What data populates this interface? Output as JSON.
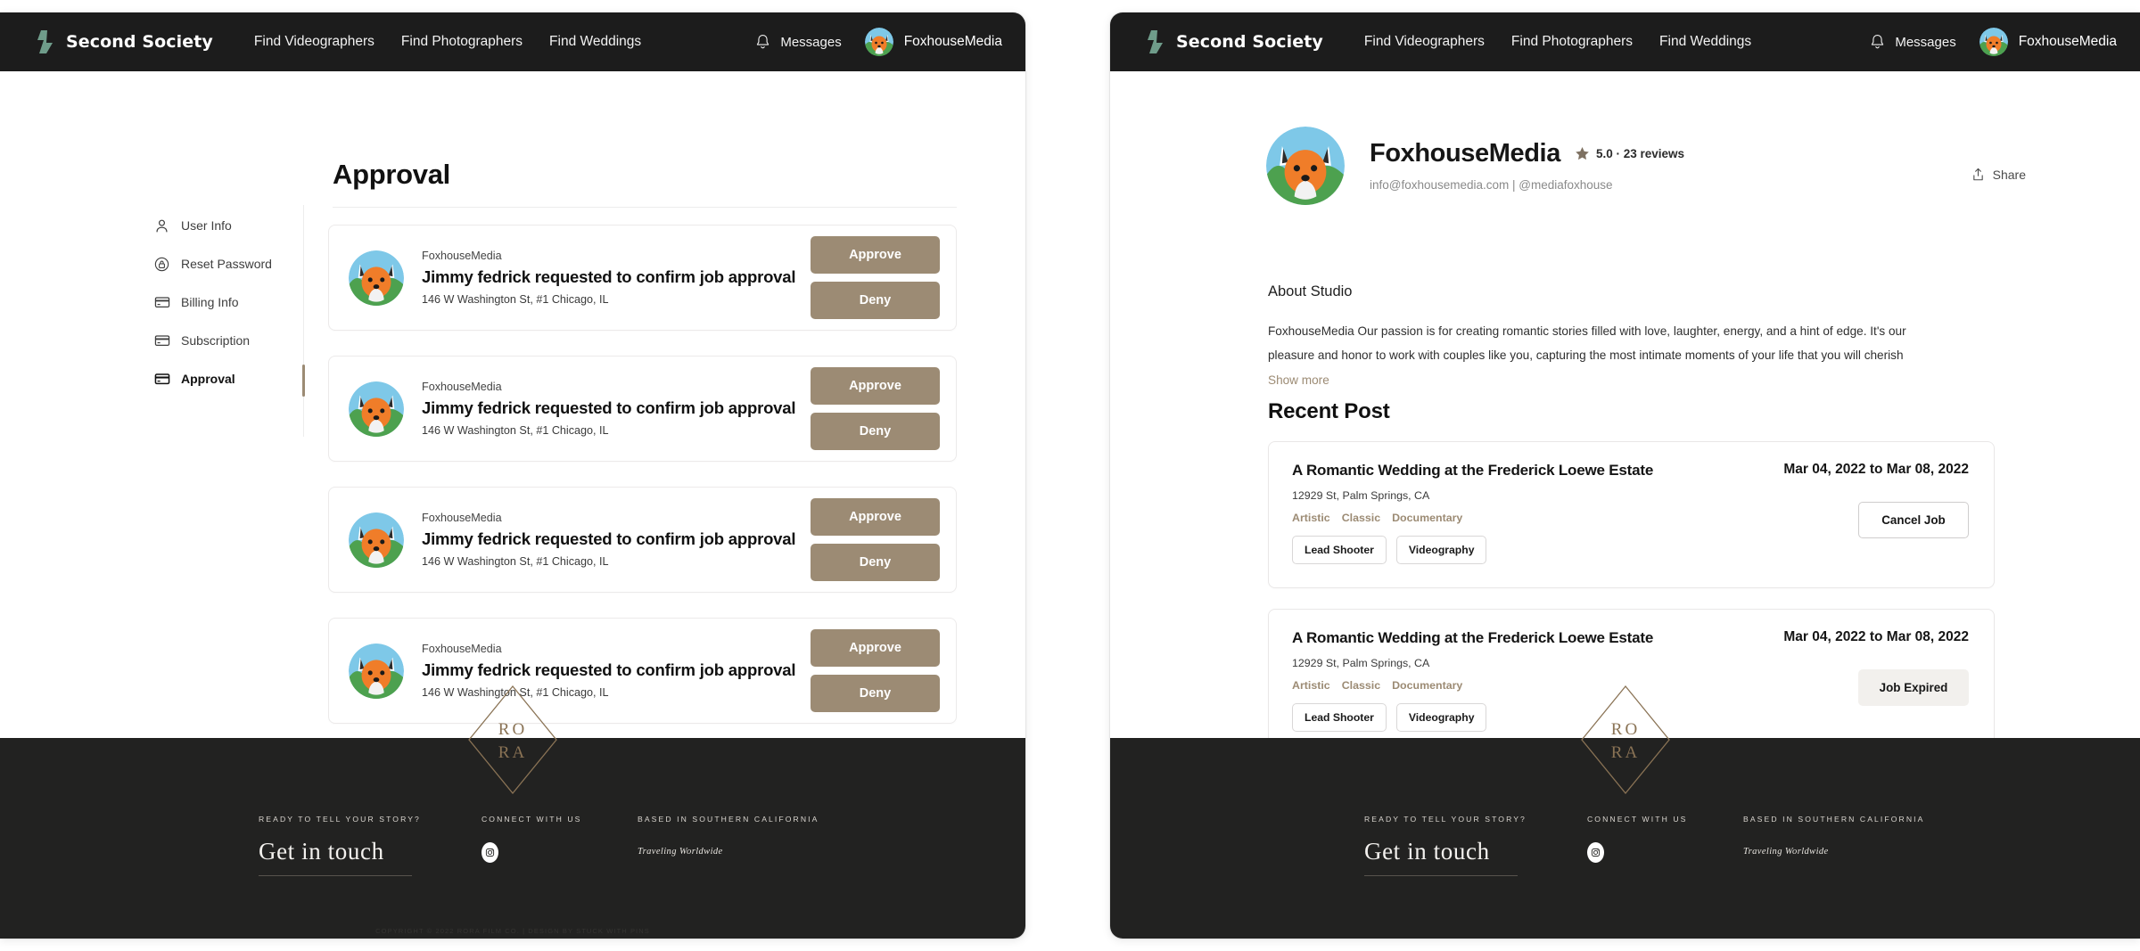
{
  "colors": {
    "topbar_bg": "#1c1c1c",
    "footer_bg": "#222221",
    "accent_tan": "#9c8b74",
    "brand_green": "#6f9c8a",
    "expired_bg": "#f2f0ed"
  },
  "topbar": {
    "brand_name": "Second Society",
    "nav": [
      {
        "label": "Find Videographers"
      },
      {
        "label": "Find Photographers"
      },
      {
        "label": "Find Weddings"
      }
    ],
    "messages_label": "Messages",
    "user_name": "FoxhouseMedia"
  },
  "left_panel": {
    "page_title": "Approval",
    "sidebar": [
      {
        "label": "User Info",
        "icon": "user-icon",
        "active": false
      },
      {
        "label": "Reset Password",
        "icon": "lock-circle-icon",
        "active": false
      },
      {
        "label": "Billing Info",
        "icon": "credit-card-icon",
        "active": false
      },
      {
        "label": "Subscription",
        "icon": "credit-card-icon",
        "active": false
      },
      {
        "label": "Approval",
        "icon": "credit-card-icon",
        "active": true
      }
    ],
    "approve_label": "Approve",
    "deny_label": "Deny",
    "cards": [
      {
        "studio": "FoxhouseMedia",
        "message": "Jimmy fedrick requested to confirm job approval",
        "address": "146 W Washington St, #1 Chicago, IL"
      },
      {
        "studio": "FoxhouseMedia",
        "message": "Jimmy fedrick requested to confirm job approval",
        "address": "146 W Washington St, #1 Chicago, IL"
      },
      {
        "studio": "FoxhouseMedia",
        "message": "Jimmy fedrick requested to confirm job approval",
        "address": "146 W Washington St, #1 Chicago, IL"
      },
      {
        "studio": "FoxhouseMedia",
        "message": "Jimmy fedrick requested to confirm job approval",
        "address": "146 W Washington St, #1 Chicago, IL"
      }
    ]
  },
  "right_panel": {
    "profile": {
      "name": "FoxhouseMedia",
      "rating": "5.0 · 23 reviews",
      "contact": "info@foxhousemedia.com | @mediafoxhouse",
      "share_label": "Share"
    },
    "about": {
      "heading": "About Studio",
      "body": "FoxhouseMedia Our passion is for creating romantic stories filled with love, laughter, energy, and a hint of edge. It's our pleasure and honor to work with couples like you, capturing the most intimate moments of your life that you will cherish ",
      "show_more": "Show more"
    },
    "recent_post_heading": "Recent Post",
    "jobs": [
      {
        "title": "A Romantic Wedding at the Frederick Loewe Estate",
        "address": "12929 St, Palm Springs, CA",
        "tags": [
          "Artistic",
          "Classic",
          "Documentary"
        ],
        "roles": [
          "Lead Shooter",
          "Videography"
        ],
        "dates": "Mar 04, 2022 to Mar 08, 2022",
        "status_label": "Cancel Job",
        "status_type": "cancel"
      },
      {
        "title": "A Romantic Wedding at the Frederick Loewe Estate",
        "address": "12929 St, Palm Springs, CA",
        "tags": [
          "Artistic",
          "Classic",
          "Documentary"
        ],
        "roles": [
          "Lead Shooter",
          "Videography"
        ],
        "dates": "Mar 04, 2022 to Mar 08, 2022",
        "status_label": "Job Expired",
        "status_type": "expired"
      }
    ]
  },
  "footer": {
    "logo_top": "RO",
    "logo_bottom": "RA",
    "col_a_kicker": "READY TO TELL YOUR STORY?",
    "col_a_title": "Get in touch",
    "col_b_kicker": "CONNECT WITH US",
    "col_c_kicker": "BASED IN SOUTHERN CALIFORNIA",
    "col_c_note": "Traveling Worldwide",
    "copyright": "COPYRIGHT © 2022 RORA FILM CO.  |  DESIGN BY STUCK WITH PINS"
  }
}
